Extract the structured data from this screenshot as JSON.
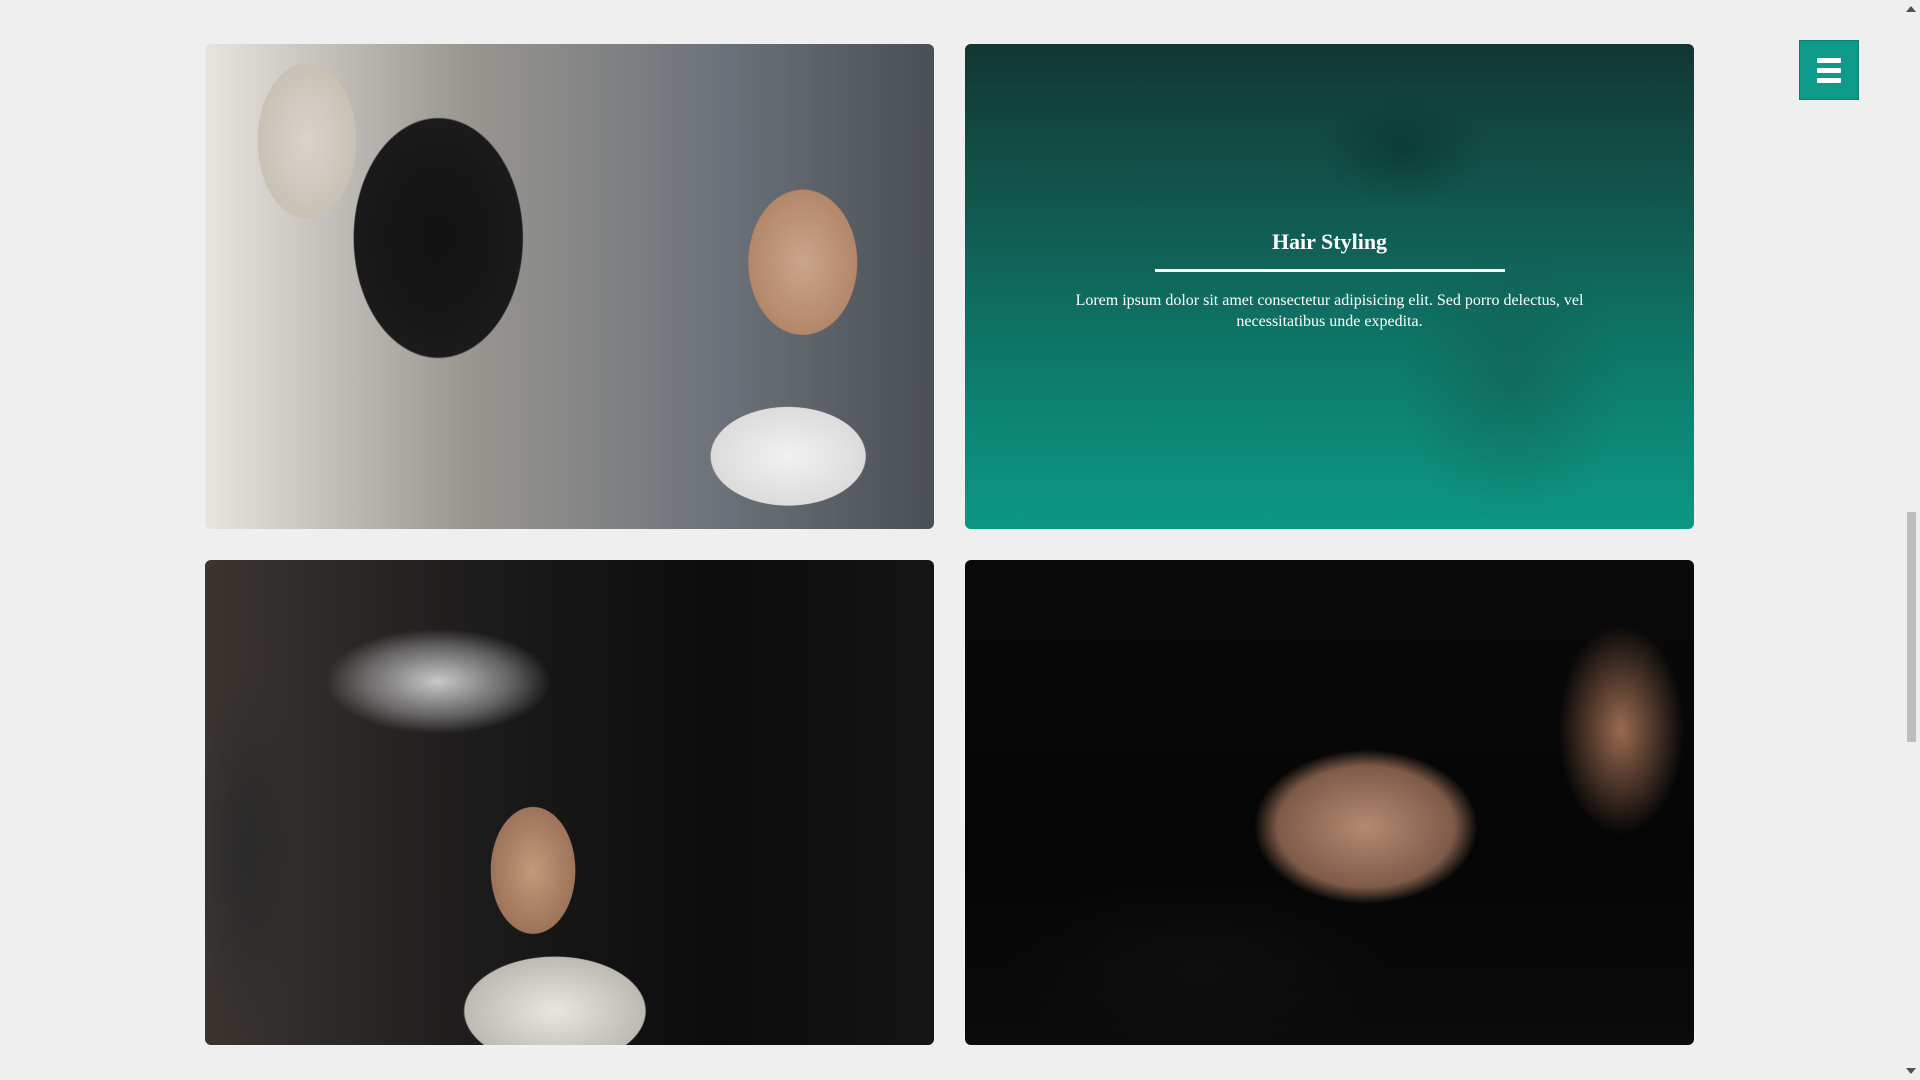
{
  "gallery": {
    "cards": [
      {
        "photo_subject": "stylist cutting man's hair"
      },
      {
        "photo_subject": "barber shaving client",
        "caption_title": "Hair Styling",
        "caption_text": "Lorem ipsum dolor sit amet consectetur adipisicing elit. Sed porro delectus, vel necessitatibus unde expedita."
      },
      {
        "photo_subject": "barber spraying water on hair"
      },
      {
        "photo_subject": "man getting hair washed"
      }
    ]
  },
  "menu": {
    "icon": "hamburger-icon"
  },
  "colors": {
    "accent": "#0d9a88",
    "background": "#efefef"
  }
}
